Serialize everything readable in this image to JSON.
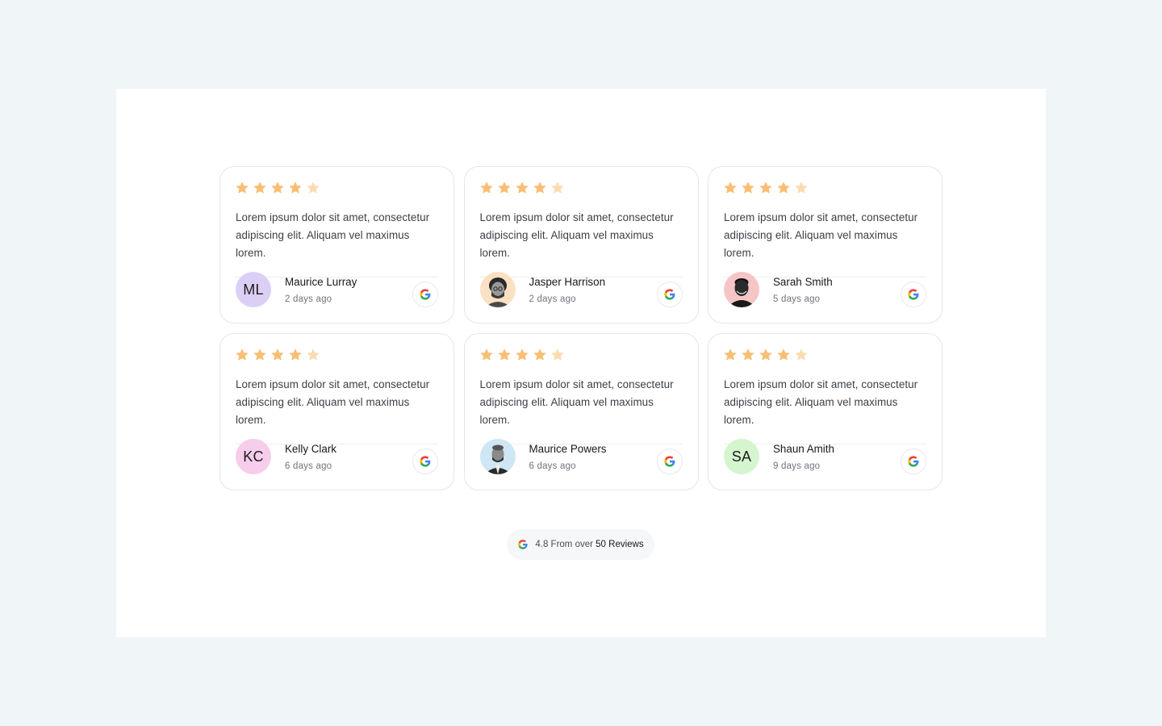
{
  "colors": {
    "star_filled": "#f8be74",
    "star_empty": "#fbdcb2",
    "page_bg": "#f0f5f8",
    "panel_bg": "#ffffff"
  },
  "reviews": [
    {
      "rating": 4,
      "text": "Lorem ipsum dolor sit amet, consectetur adipiscing elit. Aliquam vel maximus lorem.",
      "name": "Maurice Lurray",
      "time": "2 days ago",
      "avatar": {
        "type": "initials",
        "initials": "ML",
        "color": "#dccff6"
      },
      "source_icon": "google-icon"
    },
    {
      "rating": 4,
      "text": "Lorem ipsum dolor sit amet, consectetur adipiscing elit. Aliquam vel maximus lorem.",
      "name": "Jasper Harrison",
      "time": "2 days ago",
      "avatar": {
        "type": "photo",
        "color": "#fbe1c4"
      },
      "source_icon": "google-icon"
    },
    {
      "rating": 4,
      "text": "Lorem ipsum dolor sit amet, consectetur adipiscing elit. Aliquam vel maximus lorem.",
      "name": "Sarah Smith",
      "time": "5 days ago",
      "avatar": {
        "type": "photo",
        "color": "#f6c6c6"
      },
      "source_icon": "google-icon"
    },
    {
      "rating": 4,
      "text": "Lorem ipsum dolor sit amet, consectetur adipiscing elit. Aliquam vel maximus lorem.",
      "name": "Kelly Clark",
      "time": "6 days ago",
      "avatar": {
        "type": "initials",
        "initials": "KC",
        "color": "#f6cdea"
      },
      "source_icon": "google-icon"
    },
    {
      "rating": 4,
      "text": "Lorem ipsum dolor sit amet, consectetur adipiscing elit. Aliquam vel maximus lorem.",
      "name": "Maurice Powers",
      "time": "6 days ago",
      "avatar": {
        "type": "photo",
        "color": "#cfe6f3"
      },
      "source_icon": "google-icon"
    },
    {
      "rating": 4,
      "text": "Lorem ipsum dolor sit amet, consectetur adipiscing elit. Aliquam vel maximus lorem.",
      "name": "Shaun Amith",
      "time": "9 days ago",
      "avatar": {
        "type": "initials",
        "initials": "SA",
        "color": "#d5f5cf"
      },
      "source_icon": "google-icon"
    }
  ],
  "summary": {
    "rating_text": "4.8 From over",
    "count_text": "50 Reviews",
    "icon": "google-icon"
  }
}
